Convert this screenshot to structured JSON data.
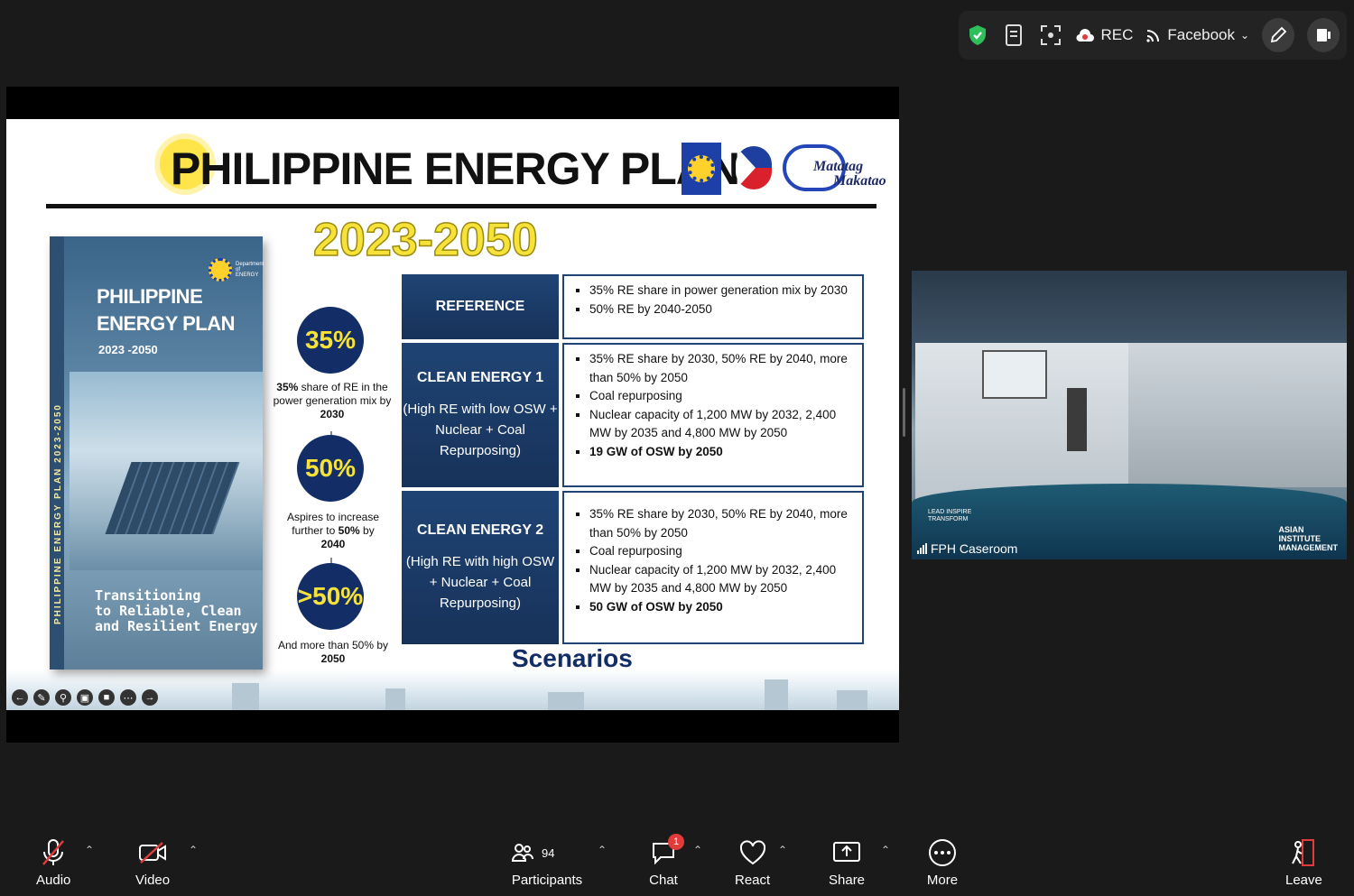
{
  "topbar": {
    "rec_label": "REC",
    "stream_label": "Facebook"
  },
  "slide": {
    "title": "PHILIPPINE ENERGY PLAN",
    "years": "2023-2050",
    "logo_text_1": "Matatag",
    "logo_text_2": "Makatao",
    "book": {
      "title_line1": "PHILIPPINE",
      "title_line2": "ENERGY PLAN",
      "years": "2023 -2050",
      "spine": "PHILIPPINE ENERGY PLAN   2023-2050",
      "dept": "Department of ENERGY",
      "subtitle_line1": "Transitioning",
      "subtitle_line2": "to Reliable, Clean",
      "subtitle_line3": "and Resilient Energy"
    },
    "targets": [
      {
        "value": "35%",
        "caption_bold": "35%",
        "caption": "share of RE in the power generation mix by",
        "year": "2030"
      },
      {
        "value": "50%",
        "caption": "Aspires to increase further to",
        "caption_bold": "50%",
        "caption2": "by",
        "year": "2040"
      },
      {
        "value": ">50%",
        "caption": "And more than 50% by",
        "year": "2050"
      }
    ],
    "scenarios_label": "Scenarios",
    "scenarios": [
      {
        "name": "REFERENCE",
        "detail": "",
        "points": [
          "35% RE share in power generation mix by 2030",
          "50% RE by 2040-2050"
        ]
      },
      {
        "name": "CLEAN ENERGY 1",
        "detail": "(High RE with low OSW + Nuclear + Coal Repurposing)",
        "points": [
          "35% RE share by 2030, 50% RE by 2040, more than 50% by 2050",
          "Coal repurposing",
          "Nuclear capacity of 1,200 MW by 2032, 2,400 MW by 2035 and 4,800 MW by 2050",
          "19 GW of OSW by 2050"
        ]
      },
      {
        "name": "CLEAN ENERGY 2",
        "detail": "(High RE with high OSW + Nuclear + Coal Repurposing)",
        "points": [
          "35% RE share by 2030, 50% RE by 2040, more than 50% by 2050",
          "Coal repurposing",
          "Nuclear capacity of 1,200 MW by 2032, 2,400 MW by 2035 and 4,800 MW by 2050",
          "50 GW of OSW by 2050"
        ]
      }
    ]
  },
  "video": {
    "participant_name": "FPH Caseroom",
    "aim_line1": "ASIAN",
    "aim_line2": "INSTITUTE",
    "aim_line3": "MANAGEMENT",
    "tagline": "LEAD INSPIRE TRANSFORM"
  },
  "toolbar": {
    "audio": "Audio",
    "video": "Video",
    "participants": "Participants",
    "participants_count": "94",
    "chat": "Chat",
    "chat_badge": "1",
    "react": "React",
    "share": "Share",
    "more": "More",
    "leave": "Leave"
  },
  "colors": {
    "navy": "#132e66",
    "accent_yellow": "#f7e23a",
    "leave_red": "#e23b3b",
    "shield_green": "#2fbf5a"
  }
}
